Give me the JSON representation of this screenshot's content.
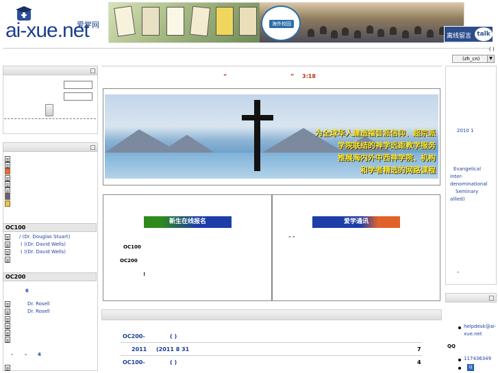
{
  "header": {
    "logo_text": "ai-xue.net",
    "logo_cn": "爱学网",
    "banner_seal_text": "OVERSEAS CAMPUS MINISTRIES",
    "banner_seal_cn": "海外校园",
    "talk_label": "离线留言",
    "talk_icon_text": "talk"
  },
  "language": {
    "parens": "( )",
    "selected": "(zh_cn)"
  },
  "center": {
    "title_open_quote": "“",
    "title_close_quote": "”",
    "title_ref": "3:18",
    "hero_lines": [
      "为全球华人建造福音派信仰、超宗派",
      "学院联结的神学远距教学服务",
      "推展海内外中西神学院、机构",
      "和学者精选的网路课程"
    ],
    "left_box": {
      "banner_label": "新生在线报名",
      "items": [
        "OC100",
        "OC200",
        "!"
      ]
    },
    "right_box": {
      "banner_label": "爱学通讯",
      "quotes": "“ ”"
    },
    "courses": [
      {
        "code": "OC200-",
        "rest": "(   )",
        "count": ""
      },
      {
        "code": "2011",
        "rest": "(2011   8   31",
        "count": "7"
      },
      {
        "code": "OC100-",
        "rest": "(   )",
        "count": "4"
      }
    ]
  },
  "left": {
    "sections": {
      "oc100": {
        "title": "OC100",
        "links": [
          "/      (Dr. Douglas Stuart)",
          "( )(Dr. David Wells)",
          "( )(Dr. David Wells)"
        ]
      },
      "oc200": {
        "title": "OC200",
        "number": "6",
        "links": [
          "Dr. Rosell",
          "Dr. Rosell"
        ],
        "footer_a": "-",
        "footer_b": "–",
        "footer_num": "4"
      }
    }
  },
  "right": {
    "date": "2010  1",
    "seminary_lines": [
      "Evangelical",
      "Inter-",
      "denominational",
      "Seminary",
      "allied)"
    ],
    "dash": "–",
    "contact_email": "helpdesk@ai-",
    "contact_email_2": "xue.net",
    "qq_label": "QQ",
    "qq_number": "117436349",
    "qq_icon": "Q"
  },
  "colors": {
    "brand_blue": "#1d3f8f",
    "link_blue": "#1f3f9f",
    "title_red": "#b8361b",
    "slogan_yellow": "#ffe92c",
    "register_banner_green": "#2f8a1e",
    "newsletter_banner_orange": "#e0622a"
  }
}
